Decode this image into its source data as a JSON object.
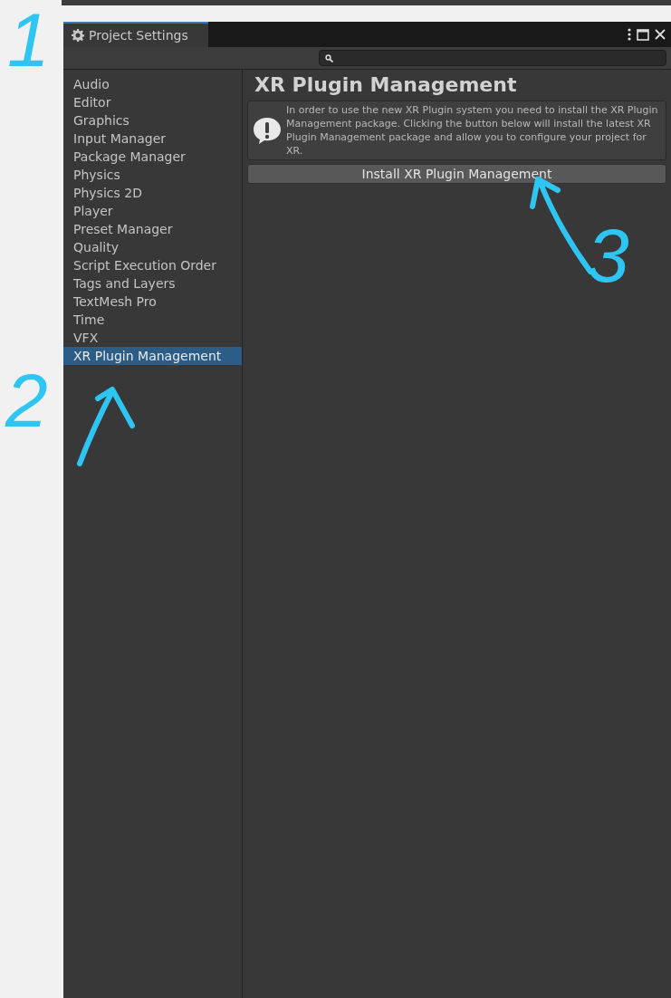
{
  "window": {
    "title": "Project Settings"
  },
  "sidebar": {
    "items": [
      {
        "label": "Audio",
        "selected": false
      },
      {
        "label": "Editor",
        "selected": false
      },
      {
        "label": "Graphics",
        "selected": false
      },
      {
        "label": "Input Manager",
        "selected": false
      },
      {
        "label": "Package Manager",
        "selected": false
      },
      {
        "label": "Physics",
        "selected": false
      },
      {
        "label": "Physics 2D",
        "selected": false
      },
      {
        "label": "Player",
        "selected": false
      },
      {
        "label": "Preset Manager",
        "selected": false
      },
      {
        "label": "Quality",
        "selected": false
      },
      {
        "label": "Script Execution Order",
        "selected": false
      },
      {
        "label": "Tags and Layers",
        "selected": false
      },
      {
        "label": "TextMesh Pro",
        "selected": false
      },
      {
        "label": "Time",
        "selected": false
      },
      {
        "label": "VFX",
        "selected": false
      },
      {
        "label": "XR Plugin Management",
        "selected": true
      }
    ]
  },
  "content": {
    "title": "XR Plugin Management",
    "help_box": {
      "text": "In order to use the new XR Plugin system you need to install the XR Plugin Management package. Clicking the button below will install the latest XR Plugin Management package and allow you to configure your project for XR."
    },
    "button": "Install XR Plugin Management"
  },
  "annotations": [
    {
      "label": "1"
    },
    {
      "label": "2"
    },
    {
      "label": "3"
    }
  ]
}
